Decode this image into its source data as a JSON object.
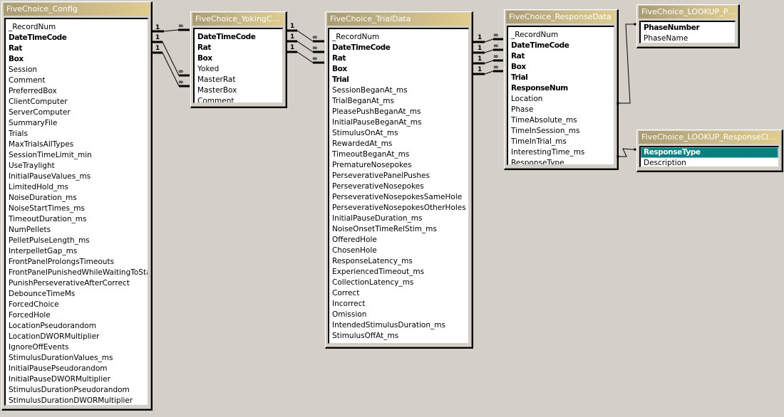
{
  "tables": {
    "config": {
      "title": "FiveChoice_Config",
      "fields": [
        {
          "name": "_RecordNum",
          "key": false
        },
        {
          "name": "DateTimeCode",
          "key": true
        },
        {
          "name": "Rat",
          "key": true
        },
        {
          "name": "Box",
          "key": true
        },
        {
          "name": "Session",
          "key": false
        },
        {
          "name": "Comment",
          "key": false
        },
        {
          "name": "PreferredBox",
          "key": false
        },
        {
          "name": "ClientComputer",
          "key": false
        },
        {
          "name": "ServerComputer",
          "key": false
        },
        {
          "name": "SummaryFile",
          "key": false
        },
        {
          "name": "Trials",
          "key": false
        },
        {
          "name": "MaxTrialsAllTypes",
          "key": false
        },
        {
          "name": "SessionTimeLimit_min",
          "key": false
        },
        {
          "name": "UseTraylight",
          "key": false
        },
        {
          "name": "InitialPauseValues_ms",
          "key": false
        },
        {
          "name": "LimitedHold_ms",
          "key": false
        },
        {
          "name": "NoiseDuration_ms",
          "key": false
        },
        {
          "name": "NoiseStartTimes_ms",
          "key": false
        },
        {
          "name": "TimeoutDuration_ms",
          "key": false
        },
        {
          "name": "NumPellets",
          "key": false
        },
        {
          "name": "PelletPulseLength_ms",
          "key": false
        },
        {
          "name": "InterpelletGap_ms",
          "key": false
        },
        {
          "name": "FrontPanelProlongsTimeouts",
          "key": false
        },
        {
          "name": "FrontPanelPunishedWhileWaitingToStart",
          "key": false
        },
        {
          "name": "PunishPerseverativeAfterCorrect",
          "key": false
        },
        {
          "name": "DebounceTimeMs",
          "key": false
        },
        {
          "name": "ForcedChoice",
          "key": false
        },
        {
          "name": "ForcedHole",
          "key": false
        },
        {
          "name": "LocationPseudorandom",
          "key": false
        },
        {
          "name": "LocationDWORMultiplier",
          "key": false
        },
        {
          "name": "IgnoreOffEvents",
          "key": false
        },
        {
          "name": "StimulusDurationValues_ms",
          "key": false
        },
        {
          "name": "InitialPausePseudorandom",
          "key": false
        },
        {
          "name": "InitialPauseDWORMultiplier",
          "key": false
        },
        {
          "name": "StimulusDurationPseudorandom",
          "key": false
        },
        {
          "name": "StimulusDurationDWORMultiplier",
          "key": false
        }
      ]
    },
    "yoking": {
      "title": "FiveChoice_YokingConfig",
      "fields": [
        {
          "name": "DateTimeCode",
          "key": true
        },
        {
          "name": "Rat",
          "key": true
        },
        {
          "name": "Box",
          "key": true
        },
        {
          "name": "Yoked",
          "key": false
        },
        {
          "name": "MasterRat",
          "key": false
        },
        {
          "name": "MasterBox",
          "key": false
        },
        {
          "name": "Comment",
          "key": false
        }
      ]
    },
    "trial": {
      "title": "FiveChoice_TrialData",
      "fields": [
        {
          "name": "_RecordNum",
          "key": false
        },
        {
          "name": "DateTimeCode",
          "key": true
        },
        {
          "name": "Rat",
          "key": true
        },
        {
          "name": "Box",
          "key": true
        },
        {
          "name": "Trial",
          "key": true
        },
        {
          "name": "SessionBeganAt_ms",
          "key": false
        },
        {
          "name": "TrialBeganAt_ms",
          "key": false
        },
        {
          "name": "PleasePushBeganAt_ms",
          "key": false
        },
        {
          "name": "InitialPauseBeganAt_ms",
          "key": false
        },
        {
          "name": "StimulusOnAt_ms",
          "key": false
        },
        {
          "name": "RewardedAt_ms",
          "key": false
        },
        {
          "name": "TimeoutBeganAt_ms",
          "key": false
        },
        {
          "name": "PrematureNosepokes",
          "key": false
        },
        {
          "name": "PerseverativePanelPushes",
          "key": false
        },
        {
          "name": "PerseverativeNosepokes",
          "key": false
        },
        {
          "name": "PerseverativeNosepokesSameHole",
          "key": false
        },
        {
          "name": "PerseverativeNosepokesOtherHoles",
          "key": false
        },
        {
          "name": "InitialPauseDuration_ms",
          "key": false
        },
        {
          "name": "NoiseOnsetTimeRelStim_ms",
          "key": false
        },
        {
          "name": "OfferedHole",
          "key": false
        },
        {
          "name": "ChosenHole",
          "key": false
        },
        {
          "name": "ResponseLatency_ms",
          "key": false
        },
        {
          "name": "ExperiencedTimeout_ms",
          "key": false
        },
        {
          "name": "CollectionLatency_ms",
          "key": false
        },
        {
          "name": "Correct",
          "key": false
        },
        {
          "name": "Incorrect",
          "key": false
        },
        {
          "name": "Omission",
          "key": false
        },
        {
          "name": "IntendedStimulusDuration_ms",
          "key": false
        },
        {
          "name": "StimulusOffAt_ms",
          "key": false
        }
      ]
    },
    "response": {
      "title": "FiveChoice_ResponseData",
      "fields": [
        {
          "name": "_RecordNum",
          "key": false
        },
        {
          "name": "DateTimeCode",
          "key": true
        },
        {
          "name": "Rat",
          "key": true
        },
        {
          "name": "Box",
          "key": true
        },
        {
          "name": "Trial",
          "key": true
        },
        {
          "name": "ResponseNum",
          "key": true
        },
        {
          "name": "Location",
          "key": false
        },
        {
          "name": "Phase",
          "key": false
        },
        {
          "name": "TimeAbsolute_ms",
          "key": false
        },
        {
          "name": "TimeInSession_ms",
          "key": false
        },
        {
          "name": "TimeInTrial_ms",
          "key": false
        },
        {
          "name": "InterestingTime_ms",
          "key": false
        },
        {
          "name": "ResponseType",
          "key": false
        }
      ]
    },
    "lookup_phase": {
      "title": "FiveChoice_LOOKUP_Ph...",
      "fields": [
        {
          "name": "PhaseNumber",
          "key": true
        },
        {
          "name": "PhaseName",
          "key": false
        }
      ]
    },
    "lookup_response": {
      "title": "FiveChoice_LOOKUP_ResponseClassif...",
      "fields": [
        {
          "name": "ResponseType",
          "key": true,
          "selected": true
        },
        {
          "name": "Description",
          "key": false
        }
      ]
    }
  },
  "relationships": {
    "one_label": "1",
    "many_label": "∞",
    "links": [
      {
        "from": "FiveChoice_Config.DateTimeCode",
        "to": "FiveChoice_YokingConfig.DateTimeCode",
        "type": "one-to-many"
      },
      {
        "from": "FiveChoice_Config.Rat",
        "to": "FiveChoice_YokingConfig.MasterRat",
        "type": "one-to-many"
      },
      {
        "from": "FiveChoice_Config.Box",
        "to": "FiveChoice_YokingConfig.MasterBox",
        "type": "one-to-many"
      },
      {
        "from": "FiveChoice_YokingConfig.DateTimeCode",
        "to": "FiveChoice_TrialData.DateTimeCode",
        "type": "one-to-many"
      },
      {
        "from": "FiveChoice_YokingConfig.Rat",
        "to": "FiveChoice_TrialData.Rat",
        "type": "one-to-many"
      },
      {
        "from": "FiveChoice_YokingConfig.Box",
        "to": "FiveChoice_TrialData.Box",
        "type": "one-to-many"
      },
      {
        "from": "FiveChoice_TrialData.DateTimeCode",
        "to": "FiveChoice_ResponseData.DateTimeCode",
        "type": "one-to-many"
      },
      {
        "from": "FiveChoice_TrialData.Rat",
        "to": "FiveChoice_ResponseData.Rat",
        "type": "one-to-many"
      },
      {
        "from": "FiveChoice_TrialData.Box",
        "to": "FiveChoice_ResponseData.Box",
        "type": "one-to-many"
      },
      {
        "from": "FiveChoice_TrialData.Trial",
        "to": "FiveChoice_ResponseData.Trial",
        "type": "one-to-many"
      },
      {
        "from": "FiveChoice_ResponseData.Phase",
        "to": "FiveChoice_LOOKUP_Ph.PhaseNumber",
        "type": "join"
      },
      {
        "from": "FiveChoice_ResponseData.ResponseType",
        "to": "FiveChoice_LOOKUP_ResponseClassif.ResponseType",
        "type": "join"
      }
    ]
  },
  "colors": {
    "background": "#d4d0c8",
    "title_bar_start": "#a89a72",
    "title_bar_end": "#e0cc8e",
    "selected_row": "#0a7f80"
  }
}
